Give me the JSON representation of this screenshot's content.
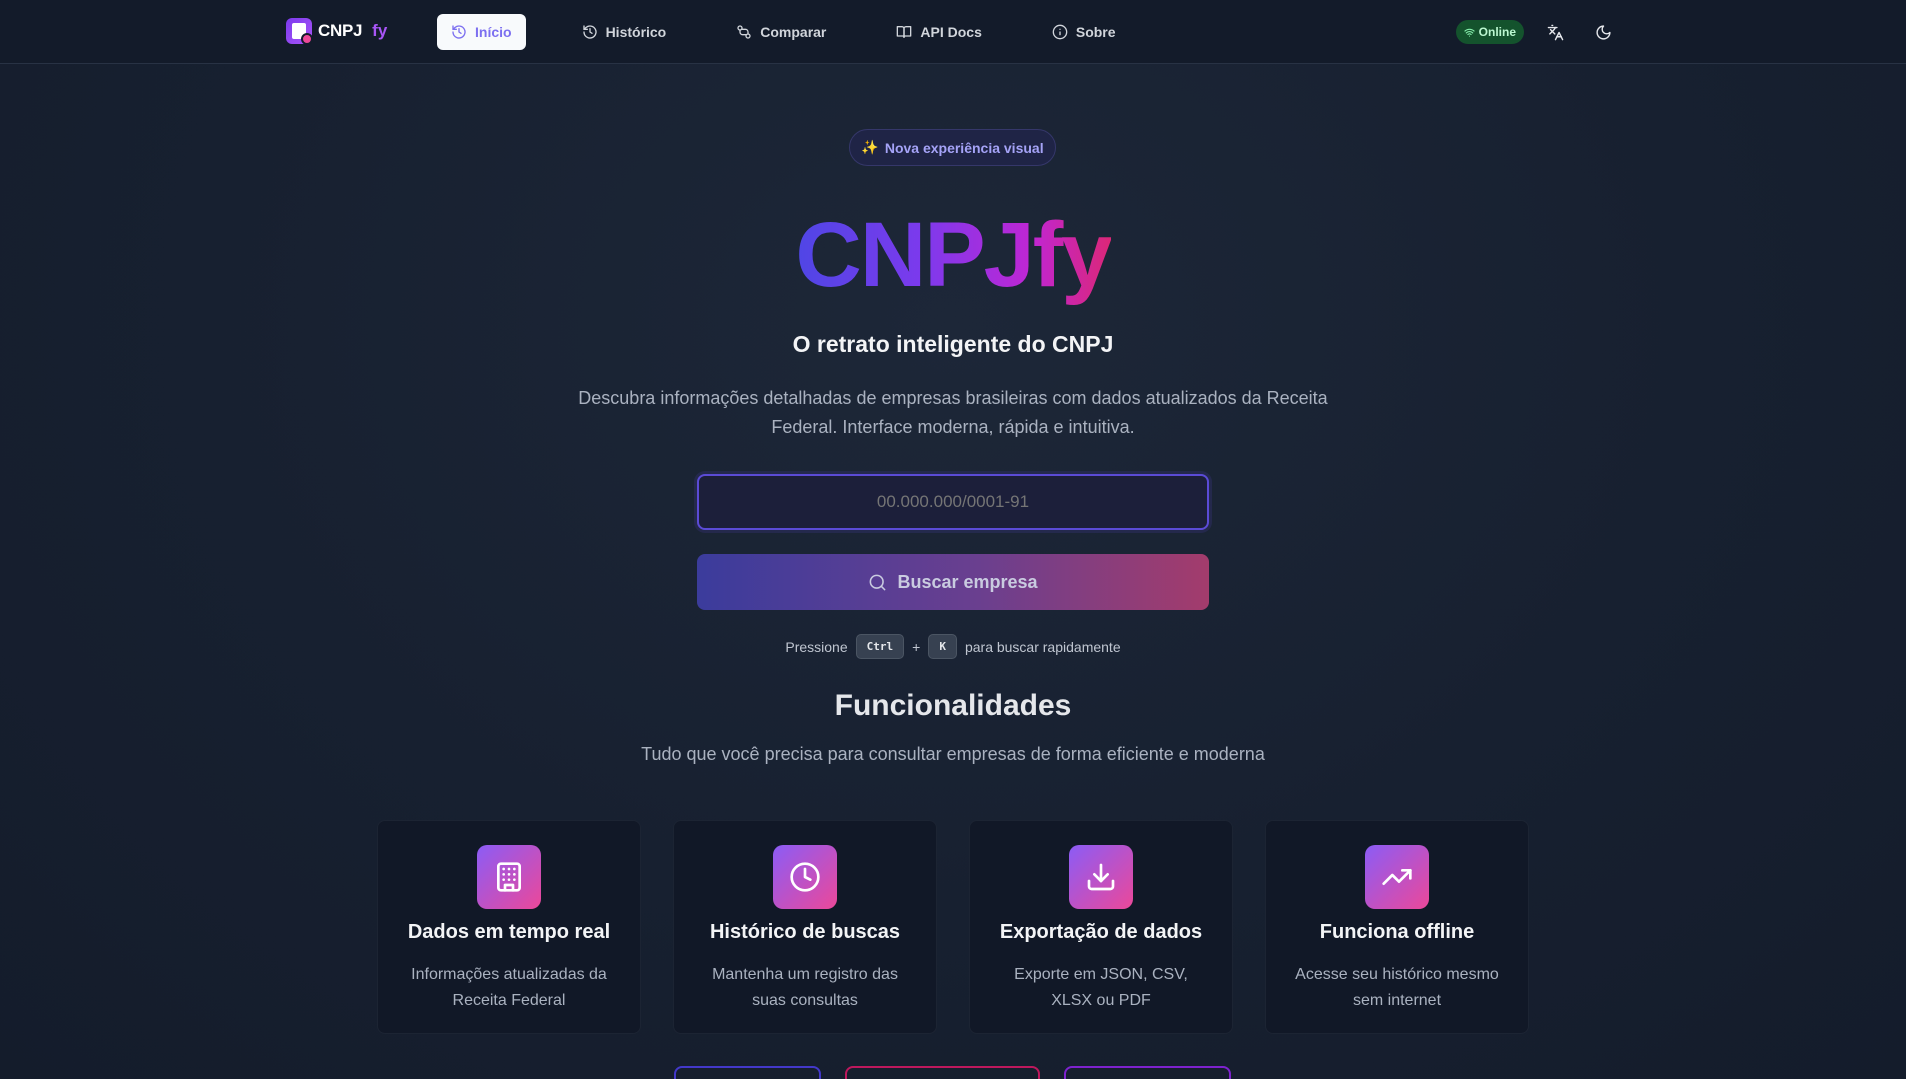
{
  "nav": {
    "logo_text": "CNPJ",
    "logo_accent": "fy",
    "links": [
      {
        "label": "Início",
        "icon": "history-icon",
        "active": true
      },
      {
        "label": "Histórico",
        "icon": "history-icon",
        "active": false
      },
      {
        "label": "Comparar",
        "icon": "compare-icon",
        "active": false
      },
      {
        "label": "API Docs",
        "icon": "book-icon",
        "active": false
      },
      {
        "label": "Sobre",
        "icon": "info-icon",
        "active": false
      }
    ],
    "status_label": "Online",
    "translate_icon": "translate-icon",
    "theme_icon": "moon-icon"
  },
  "hero": {
    "pill_emoji": "✨",
    "pill_label": "Nova experiência visual",
    "title": "CNPJfy",
    "subtitle": "O retrato inteligente do CNPJ",
    "description": "Descubra informações detalhadas de empresas brasileiras com dados atualizados da Receita Federal. Interface moderna, rápida e intuitiva.",
    "search_placeholder": "00.000.000/0001-91",
    "search_button": "Buscar empresa",
    "hint_prefix": "Pressione",
    "hint_key1": "Ctrl",
    "hint_plus": "+",
    "hint_key2": "K",
    "hint_suffix": "para buscar rapidamente"
  },
  "features": {
    "title": "Funcionalidades",
    "subtitle": "Tudo que você precisa para consultar empresas de forma eficiente e moderna",
    "cards": [
      {
        "icon": "building-icon",
        "title": "Dados em tempo real",
        "desc": "Informações atualizadas da Receita Federal"
      },
      {
        "icon": "clock-icon",
        "title": "Histórico de buscas",
        "desc": "Mantenha um registro das suas consultas"
      },
      {
        "icon": "download-icon",
        "title": "Exportação de dados",
        "desc": "Exporte em JSON, CSV, XLSX ou PDF"
      },
      {
        "icon": "trending-up-icon",
        "title": "Funciona offline",
        "desc": "Acesse seu histórico mesmo sem internet"
      }
    ]
  },
  "colors": {
    "accent": "#7c3aed",
    "pink": "#ec4899",
    "online": "#14532d"
  }
}
